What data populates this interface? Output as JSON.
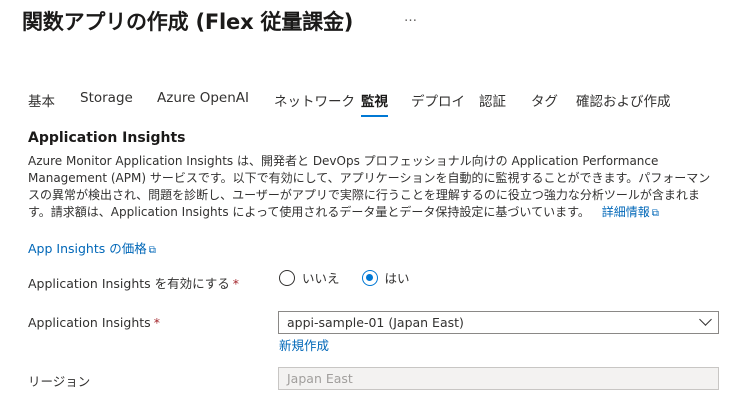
{
  "header": {
    "title": "関数アプリの作成 (Flex 従量課金)",
    "more_label": "…"
  },
  "tabs": [
    {
      "label": "基本"
    },
    {
      "label": "Storage"
    },
    {
      "label": "Azure OpenAI"
    },
    {
      "label": "ネットワーク"
    },
    {
      "label": "監視",
      "active": true
    },
    {
      "label": "デプロイ"
    },
    {
      "label": "認証"
    },
    {
      "label": "タグ"
    },
    {
      "label": "確認および作成"
    }
  ],
  "section": {
    "title": "Application Insights",
    "description": "Azure Monitor Application Insights は、開発者と DevOps プロフェッショナル向けの Application Performance Management (APM) サービスです。以下で有効にして、アプリケーションを自動的に監視することができます。パフォーマンスの異常が検出され、問題を診断し、ユーザーがアプリで実際に行うことを理解するのに役立つ強力な分析ツールが含まれます。請求額は、Application Insights によって使用されるデータ量とデータ保持設定に基づいています。",
    "learn_more": "詳細情報",
    "pricing_link": "App Insights の価格"
  },
  "form": {
    "enable": {
      "label": "Application Insights を有効にする",
      "required_mark": "*",
      "options": [
        {
          "label": "いいえ",
          "selected": false
        },
        {
          "label": "はい",
          "selected": true
        }
      ]
    },
    "insights": {
      "label": "Application Insights",
      "required_mark": "*",
      "value": "appi-sample-01 (Japan East)",
      "create_new": "新規作成"
    },
    "region": {
      "label": "リージョン",
      "value": "Japan East"
    }
  },
  "colors": {
    "accent": "#0078d4",
    "link": "#0067b8",
    "required": "#a4262c"
  }
}
